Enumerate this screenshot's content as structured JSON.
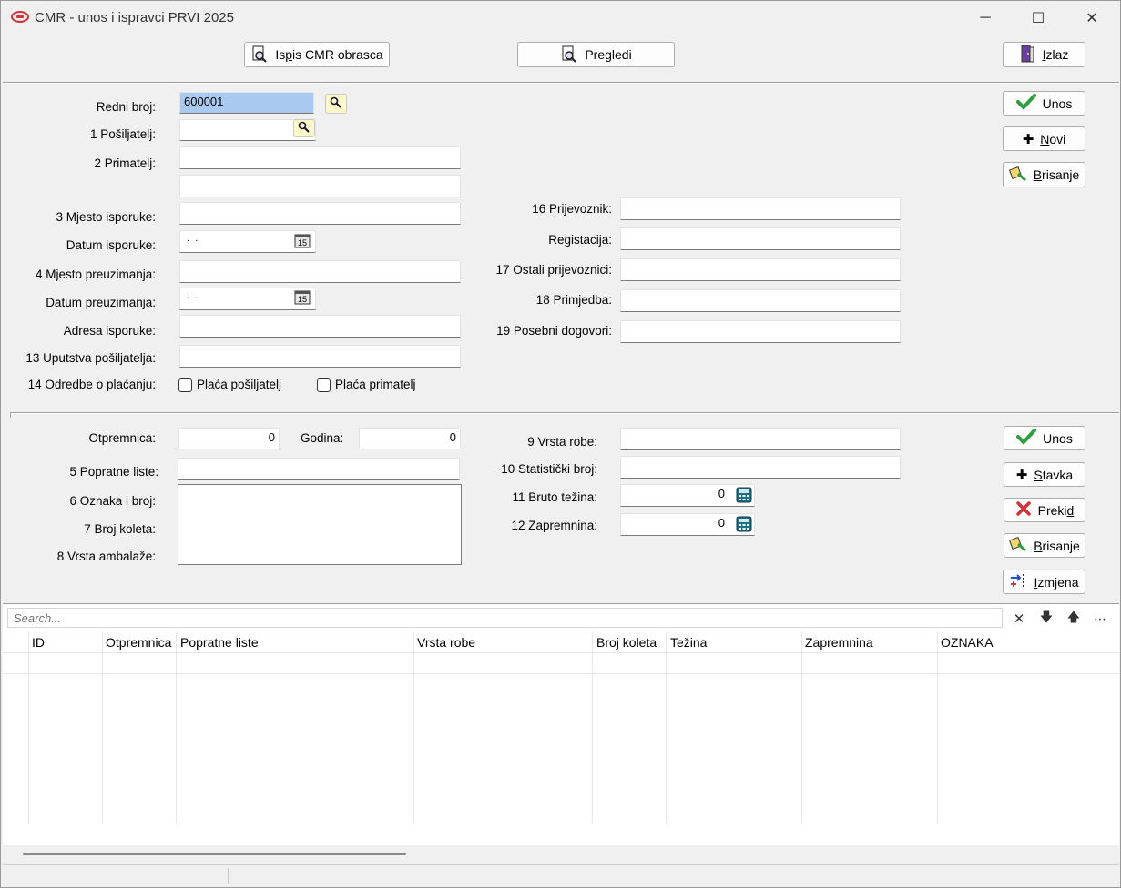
{
  "window": {
    "title": "CMR - unos i ispravci PRVI 2025",
    "minimize_glyph": "─",
    "maximize_glyph": "☐",
    "close_glyph": "✕"
  },
  "toolbar": {
    "print_pre": "Is",
    "print_u": "p",
    "print_post": "is CMR obrasca",
    "preview": "Pregledi",
    "exit_u": "I",
    "exit_post": "zlaz"
  },
  "header_form": {
    "redni_broj_label": "Redni broj:",
    "redni_broj_value": "600001",
    "posiljatelj_label": "1 Pošiljatelj:",
    "primatelj_label": "2 Primatelj:",
    "mjesto_isporuke_label": "3 Mjesto isporuke:",
    "datum_isporuke_label": "Datum isporuke:",
    "datum_isporuke_value": " .  .",
    "mjesto_preuzimanja_label": "4 Mjesto preuzimanja:",
    "datum_preuzimanja_label": "Datum preuzimanja:",
    "datum_preuzimanja_value": " .  .",
    "adresa_isporuke_label": "Adresa isporuke:",
    "uputstva_label": "13 Uputstva pošiljatelja:",
    "odredbe_label": "14 Odredbe o plaćanju:",
    "placa_posiljatelj_label": "Plaća pošiljatelj",
    "placa_primatelj_label": "Plaća primatelj",
    "prijevoznik_label": "16 Prijevoznik:",
    "registacija_label": "Registacija:",
    "ostali_label": "17 Ostali prijevoznici:",
    "primjedba_label": "18 Primjedba:",
    "posebni_label": "19 Posebni dogovori:"
  },
  "header_buttons": {
    "unos": "Unos",
    "novi_u": "N",
    "novi_post": "ovi",
    "brisanje_u": "B",
    "brisanje_post": "risanje"
  },
  "item_form": {
    "otpremnica_label": "Otpremnica:",
    "otpremnica_value": "0",
    "godina_label": "Godina:",
    "godina_value": "0",
    "popratne_label": "5 Popratne liste:",
    "oznaka_label": "6 Oznaka i broj:",
    "broj_koleta_label": "7 Broj koleta:",
    "ambalaza_label": "8 Vrsta ambalaže:",
    "vrsta_robe_label": "9 Vrsta robe:",
    "statisticki_label": "10 Statistički broj:",
    "bruto_label": "11 Bruto težina:",
    "bruto_value": "0",
    "zapremnina_label": "12 Zapremnina:",
    "zapremnina_value": "0"
  },
  "item_buttons": {
    "unos": "Unos",
    "stavka_u": "S",
    "stavka_post": "tavka",
    "prekid_pre": "Preki",
    "prekid_u": "d",
    "brisanje_u": "B",
    "brisanje_post": "risanje",
    "izmjena_u": "I",
    "izmjena_post": "zmjena"
  },
  "search": {
    "placeholder": "Search..."
  },
  "grid": {
    "columns": [
      "ID",
      "Otpremnica",
      "Popratne liste",
      "Vrsta robe",
      "Broj koleta",
      "Težina",
      "Zapremnina",
      "OZNAKA"
    ]
  },
  "colors": {
    "accent_green": "#2e9e3e",
    "accent_red": "#d13438",
    "selection": "#a9c9f0"
  }
}
